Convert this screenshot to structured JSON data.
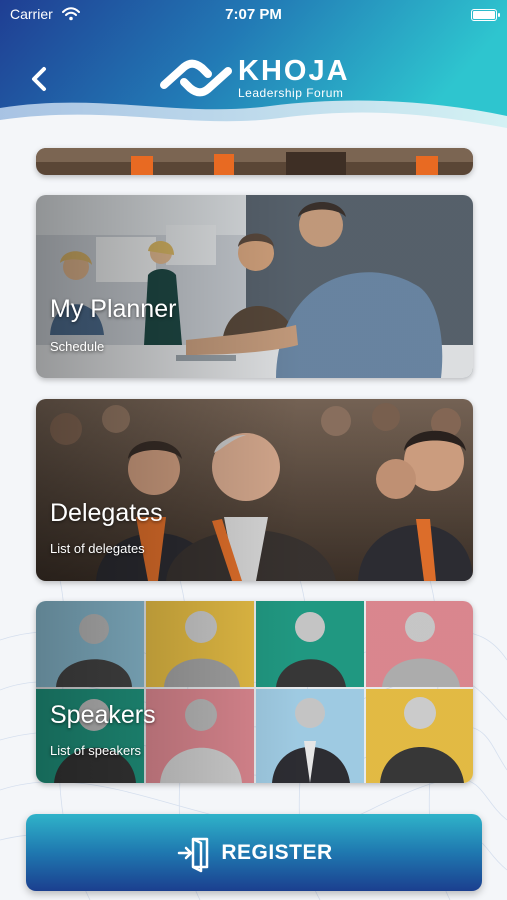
{
  "status_bar": {
    "carrier": "Carrier",
    "time": "7:07 PM"
  },
  "header": {
    "logo_title": "KHOJA",
    "logo_subtitle": "Leadership Forum"
  },
  "cards": [
    {
      "title": "My Planner",
      "subtitle": "Schedule"
    },
    {
      "title": "Delegates",
      "subtitle": "List of delegates"
    },
    {
      "title": "Speakers",
      "subtitle": "List of speakers"
    }
  ],
  "register": {
    "label": "REGISTER"
  },
  "colors": {
    "header_dark": "#1b3f8f",
    "header_light": "#2fc3cf",
    "button_top": "#2fb3c9",
    "button_bottom": "#1b3f8f"
  },
  "icons": {
    "back": "chevron-left-icon",
    "wifi": "wifi-icon",
    "battery": "battery-icon",
    "register": "door-enter-icon"
  }
}
